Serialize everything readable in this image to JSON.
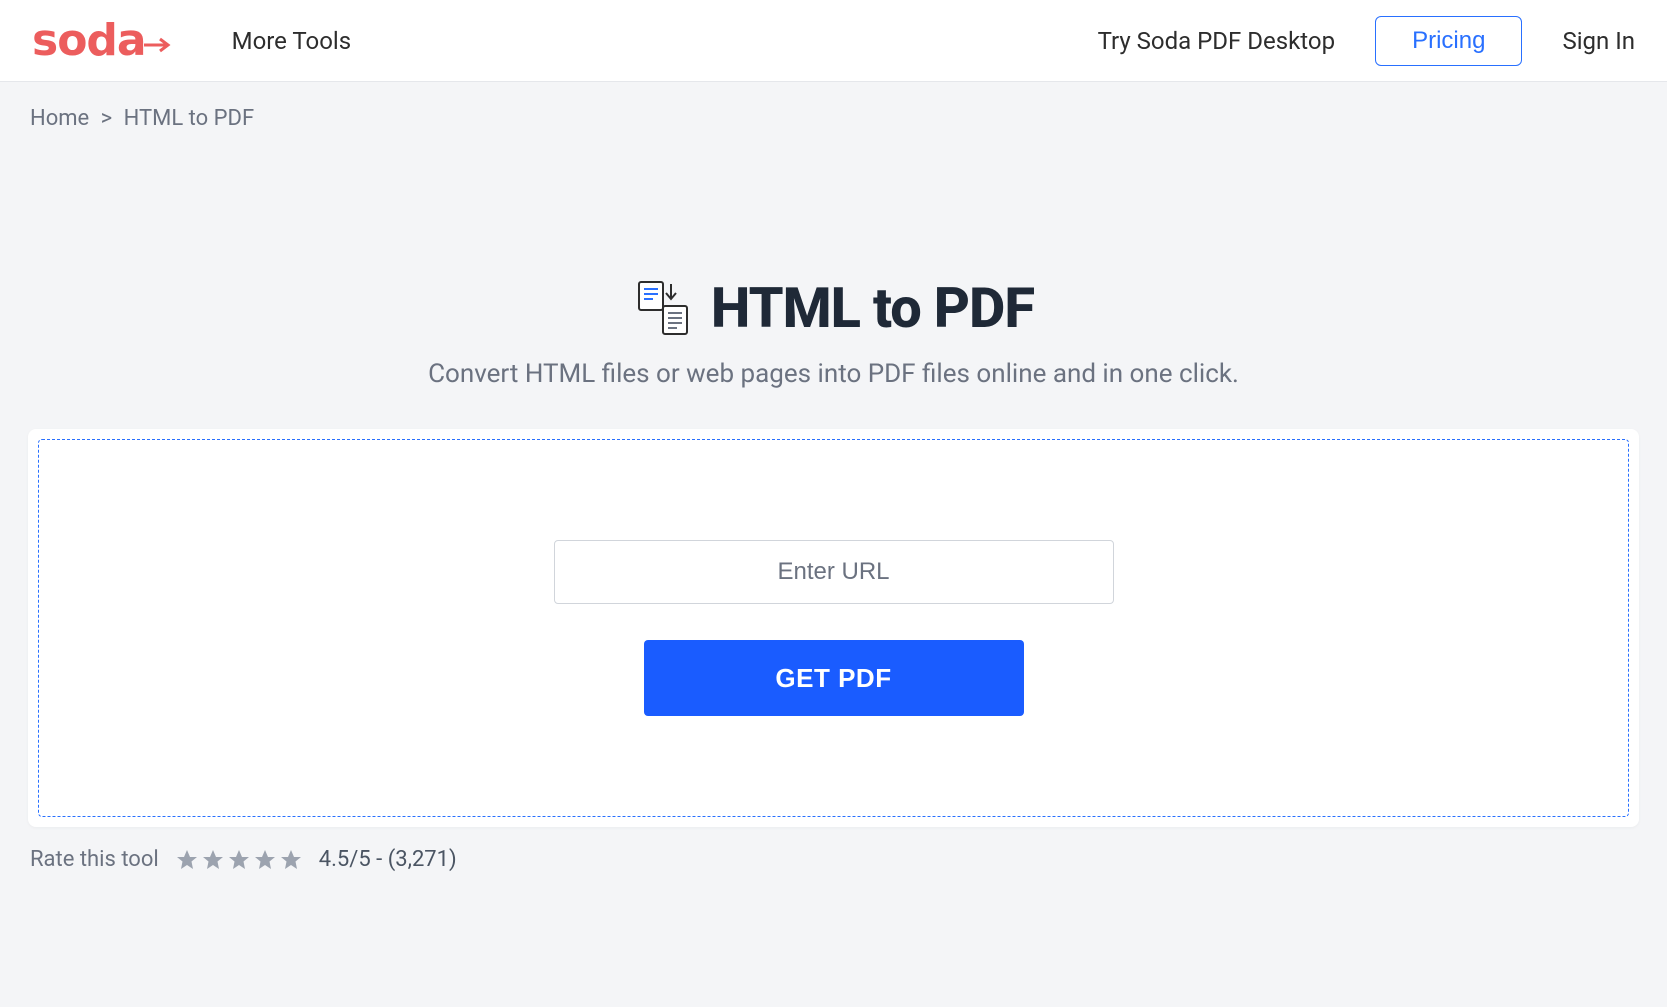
{
  "header": {
    "logo_text": "soda",
    "more_tools": "More Tools",
    "try_desktop": "Try Soda PDF Desktop",
    "pricing": "Pricing",
    "sign_in": "Sign In"
  },
  "breadcrumb": {
    "home": "Home",
    "sep": ">",
    "current": "HTML to PDF"
  },
  "main": {
    "title": "HTML to PDF",
    "subtitle": "Convert HTML files or web pages into PDF files online and in one click.",
    "url_placeholder": "Enter URL",
    "get_pdf": "GET PDF"
  },
  "rating": {
    "label": "Rate this tool",
    "text": "4.5/5 - (3,271)"
  }
}
